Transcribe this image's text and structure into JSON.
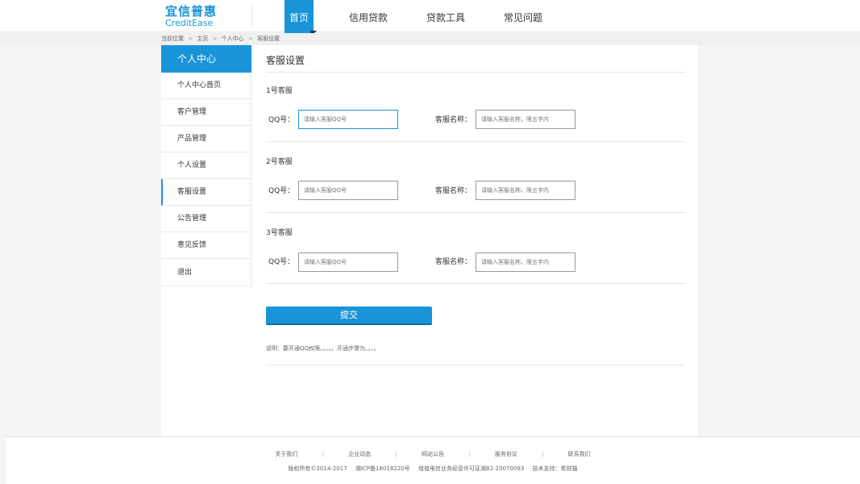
{
  "logo": {
    "cn": "宜信普惠",
    "en": "CreditEase"
  },
  "nav": {
    "items": [
      {
        "label": "首页",
        "active": true
      },
      {
        "label": "信用贷款",
        "active": false
      },
      {
        "label": "贷款工具",
        "active": false
      },
      {
        "label": "常见问题",
        "active": false
      }
    ]
  },
  "breadcrumb": [
    "当前位置",
    "主页",
    "个人中心",
    "客服设置"
  ],
  "sidebar": {
    "title": "个人中心",
    "items": [
      {
        "label": "个人中心首页"
      },
      {
        "label": "客户管理"
      },
      {
        "label": "产品管理"
      },
      {
        "label": "个人设置"
      },
      {
        "label": "客服设置",
        "active": true
      },
      {
        "label": "公告管理"
      },
      {
        "label": "意见反馈"
      },
      {
        "label": "退出"
      }
    ]
  },
  "main": {
    "title": "客服设置",
    "sections": [
      {
        "heading": "1号客服",
        "qq_label": "QQ号：",
        "qq_placeholder": "请输入客服QQ号",
        "name_label": "客服名称：",
        "name_placeholder": "请输入客服名称，限五字内"
      },
      {
        "heading": "2号客服",
        "qq_label": "QQ号：",
        "qq_placeholder": "请输入客服QQ号",
        "name_label": "客服名称：",
        "name_placeholder": "请输入客服名称，限五字内"
      },
      {
        "heading": "3号客服",
        "qq_label": "QQ号：",
        "qq_placeholder": "请输入客服QQ号",
        "name_label": "客服名称：",
        "name_placeholder": "请输入客服名称，限五字内"
      }
    ],
    "submit_label": "提交",
    "note": "说明：要开通QQ权限。。。。。开通步骤为。。。。"
  },
  "footer": {
    "links": [
      "关于我们",
      "企业动态",
      "网站公告",
      "服务协议",
      "联系我们"
    ],
    "separator": "|",
    "copyright": "版权所有©2014-2017",
    "icp": "湘ICP备16018220号",
    "license": "增值电信业务经营许可证湘B2-20070093",
    "tech": "技术支持：希财猫"
  },
  "colors": {
    "accent": "#1a94d8",
    "accent_dark": "#123b5e"
  }
}
